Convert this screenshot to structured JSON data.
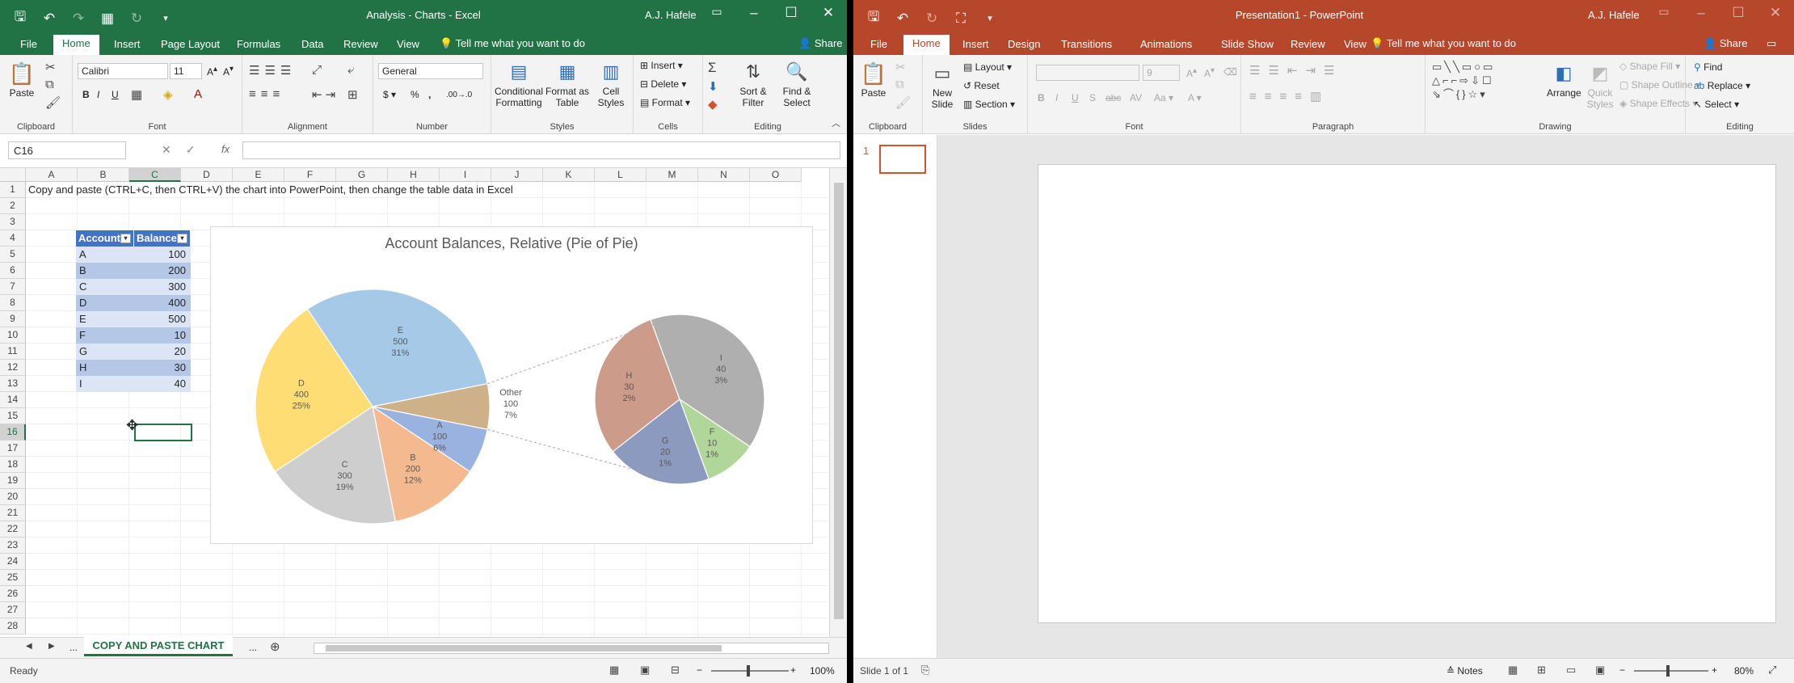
{
  "excel": {
    "title": "Analysis - Charts - Excel",
    "user": "A.J. Hafele",
    "tabs": [
      "File",
      "Home",
      "Insert",
      "Page Layout",
      "Formulas",
      "Data",
      "Review",
      "View"
    ],
    "tell_me": "Tell me what you want to do",
    "share": "Share",
    "ribbon": {
      "clipboard": {
        "label": "Clipboard",
        "paste": "Paste"
      },
      "font": {
        "label": "Font",
        "name": "Calibri",
        "size": "11"
      },
      "alignment": {
        "label": "Alignment"
      },
      "number": {
        "label": "Number",
        "format": "General"
      },
      "styles": {
        "label": "Styles",
        "conditional": "Conditional Formatting",
        "format_table": "Format as Table",
        "cell_styles": "Cell Styles"
      },
      "cells": {
        "label": "Cells",
        "insert": "Insert",
        "delete": "Delete",
        "format": "Format"
      },
      "editing": {
        "label": "Editing",
        "sort": "Sort & Filter",
        "find": "Find & Select"
      }
    },
    "name_box": "C16",
    "fx": "fx",
    "columns": [
      "A",
      "B",
      "C",
      "D",
      "E",
      "F",
      "G",
      "H",
      "I",
      "J",
      "K",
      "L",
      "M",
      "N",
      "O"
    ],
    "rows": [
      "1",
      "2",
      "3",
      "4",
      "5",
      "6",
      "7",
      "8",
      "9",
      "10",
      "11",
      "12",
      "13",
      "14",
      "15",
      "16",
      "17",
      "18",
      "19",
      "20",
      "21",
      "22",
      "23",
      "24",
      "25",
      "26",
      "27",
      "28"
    ],
    "instruction": "Copy and paste (CTRL+C, then CTRL+V) the chart into PowerPoint, then change the table data in Excel",
    "table": {
      "headers": [
        "Account",
        "Balance"
      ],
      "rows": [
        {
          "account": "A",
          "balance": "100"
        },
        {
          "account": "B",
          "balance": "200"
        },
        {
          "account": "C",
          "balance": "300"
        },
        {
          "account": "D",
          "balance": "400"
        },
        {
          "account": "E",
          "balance": "500"
        },
        {
          "account": "F",
          "balance": "10"
        },
        {
          "account": "G",
          "balance": "20"
        },
        {
          "account": "H",
          "balance": "30"
        },
        {
          "account": "I",
          "balance": "40"
        }
      ]
    },
    "sheet_tab": "COPY AND PASTE CHART",
    "sheet_more": "...",
    "status": "Ready",
    "zoom": "100%"
  },
  "powerpoint": {
    "title": "Presentation1 - PowerPoint",
    "user": "A.J. Hafele",
    "tabs": [
      "File",
      "Home",
      "Insert",
      "Design",
      "Transitions",
      "Animations",
      "Slide Show",
      "Review",
      "View"
    ],
    "tell_me": "Tell me what you want to do",
    "share": "Share",
    "ribbon": {
      "clipboard": {
        "label": "Clipboard",
        "paste": "Paste"
      },
      "slides": {
        "label": "Slides",
        "new_slide": "New Slide",
        "layout": "Layout",
        "reset": "Reset",
        "section": "Section"
      },
      "font": {
        "label": "Font",
        "size": "9"
      },
      "paragraph": {
        "label": "Paragraph"
      },
      "drawing": {
        "label": "Drawing",
        "arrange": "Arrange",
        "quick_styles": "Quick Styles",
        "shape_fill": "Shape Fill",
        "shape_outline": "Shape Outline",
        "shape_effects": "Shape Effects"
      },
      "editing": {
        "label": "Editing",
        "find": "Find",
        "replace": "Replace",
        "select": "Select"
      }
    },
    "slide_number": "1",
    "status": "Slide 1 of 1",
    "notes": "Notes",
    "zoom": "80%"
  },
  "chart_data": {
    "type": "pie",
    "title": "Account Balances, Relative (Pie of Pie)",
    "main_pie": [
      {
        "label": "E",
        "value": 500,
        "percent": "31%",
        "color": "#9dc3e6"
      },
      {
        "label": "Other",
        "value": 100,
        "percent": "7%",
        "color": "#c9a77c"
      },
      {
        "label": "A",
        "value": 100,
        "percent": "6%",
        "color": "#8faadc"
      },
      {
        "label": "B",
        "value": 200,
        "percent": "12%",
        "color": "#f4b183"
      },
      {
        "label": "C",
        "value": 300,
        "percent": "19%",
        "color": "#c9c9c9"
      },
      {
        "label": "D",
        "value": 400,
        "percent": "25%",
        "color": "#ffd966"
      }
    ],
    "secondary_pie": [
      {
        "label": "I",
        "value": 40,
        "percent": "3%",
        "color": "#a6a6a6"
      },
      {
        "label": "F",
        "value": 10,
        "percent": "1%",
        "color": "#a9d18e"
      },
      {
        "label": "G",
        "value": 20,
        "percent": "1%",
        "color": "#7f8fb8"
      },
      {
        "label": "H",
        "value": 30,
        "percent": "2%",
        "color": "#c7907c"
      }
    ]
  }
}
